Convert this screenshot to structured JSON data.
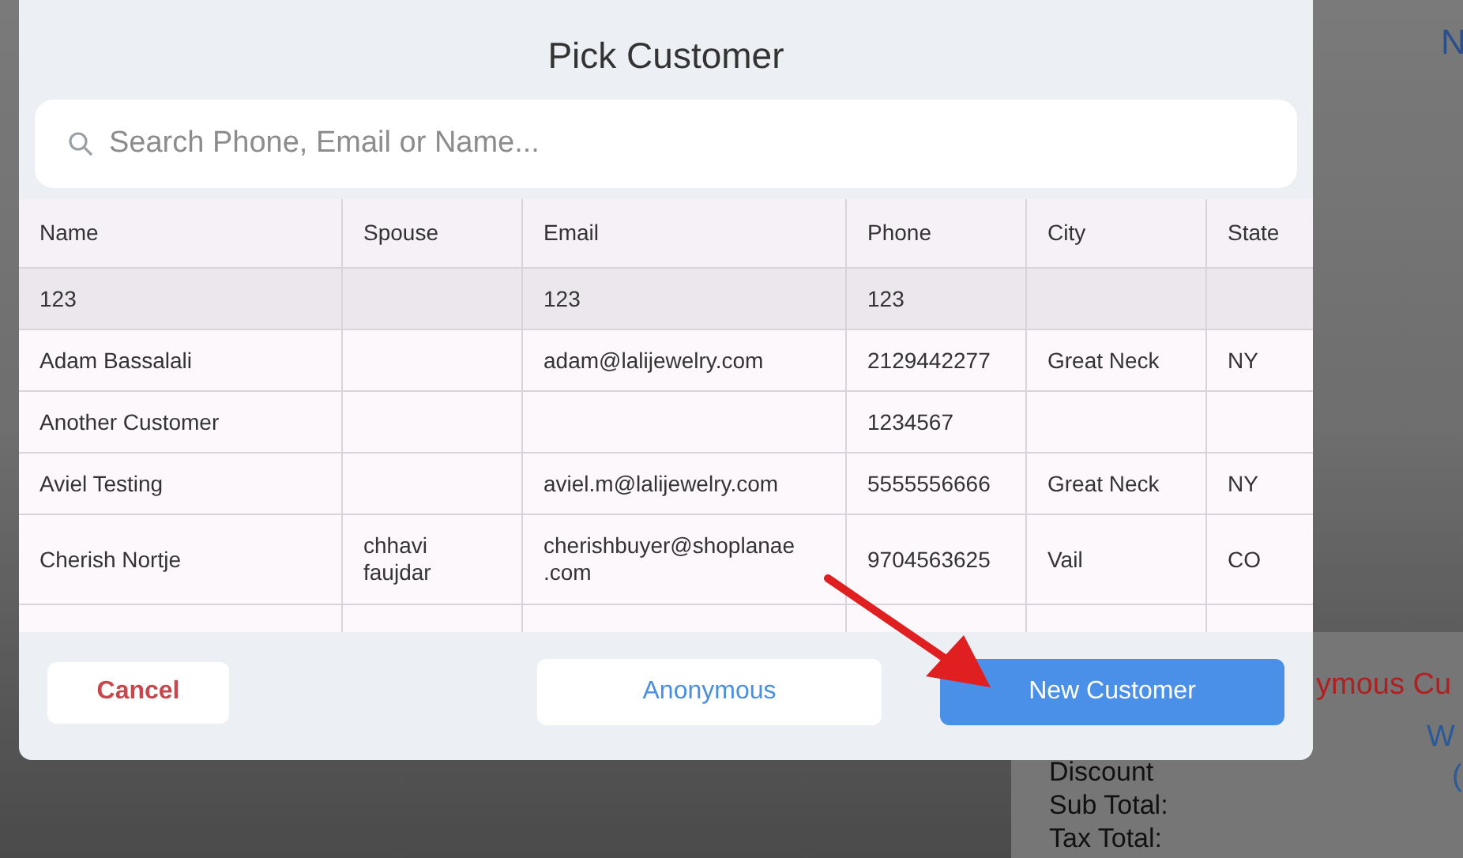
{
  "background": {
    "top_right_fragment": "N",
    "customer_label": "ymous Cu",
    "link_fragment": "W",
    "paren_fragment": "(",
    "totals": [
      "Discount",
      "Sub Total:",
      "Tax Total:"
    ]
  },
  "dialog": {
    "title": "Pick Customer",
    "search": {
      "placeholder": "Search Phone, Email or Name..."
    },
    "table": {
      "columns": [
        "Name",
        "Spouse",
        "Email",
        "Phone",
        "City",
        "State"
      ],
      "rows": [
        {
          "selected": true,
          "cells": [
            "123",
            "",
            "123",
            "123",
            "",
            ""
          ]
        },
        {
          "selected": false,
          "cells": [
            "Adam Bassalali",
            "",
            "adam@lalijewelry.com",
            "2129442277",
            "Great Neck",
            "NY"
          ]
        },
        {
          "selected": false,
          "cells": [
            "Another  Customer",
            "",
            "",
            "1234567",
            "",
            ""
          ]
        },
        {
          "selected": false,
          "cells": [
            "Aviel Testing",
            "",
            "aviel.m@lalijewelry.com",
            "5555556666",
            "Great Neck",
            "NY"
          ]
        },
        {
          "selected": false,
          "cells": [
            "Cherish Nortje",
            "chhavi faujdar",
            "cherishbuyer@shoplanae .com",
            "9704563625",
            "Vail",
            "CO"
          ]
        }
      ]
    },
    "buttons": [
      {
        "kind": "cancel",
        "label": "Cancel"
      },
      {
        "kind": "secondary",
        "label": "Anonymous"
      },
      {
        "kind": "primary",
        "label": "New Customer"
      }
    ]
  }
}
